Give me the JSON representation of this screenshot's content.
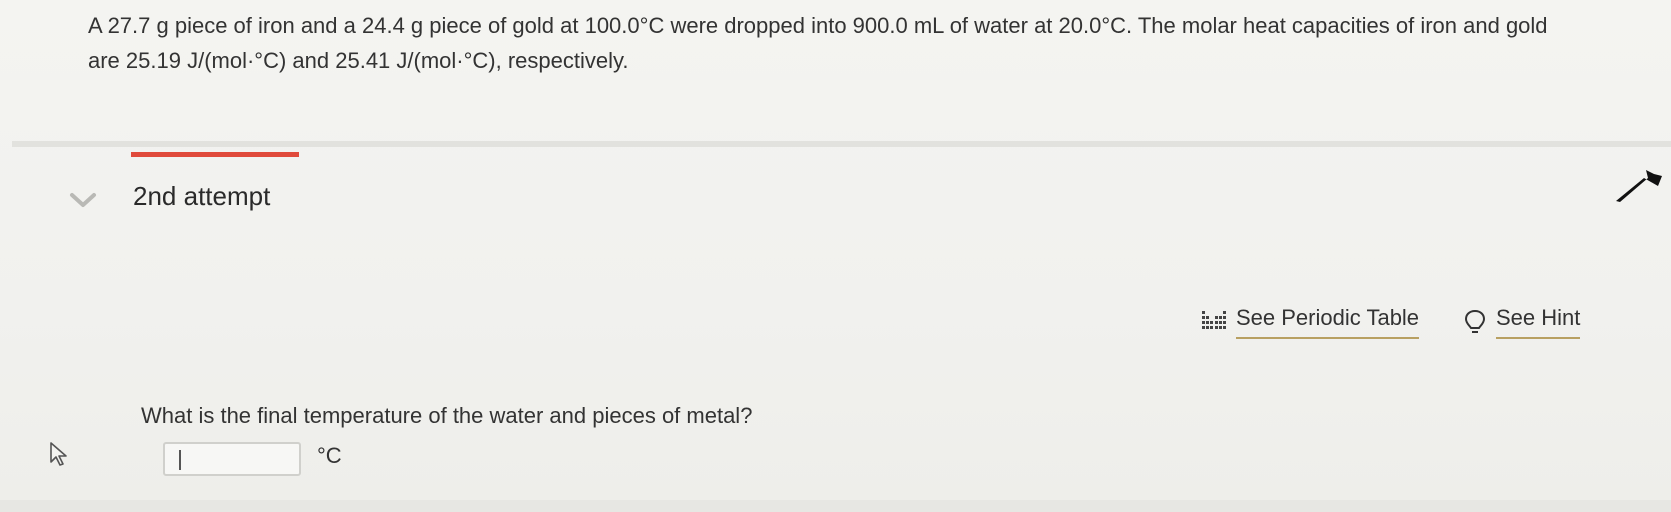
{
  "problem": {
    "line1": "A 27.7 g piece of iron and a 24.4 g piece of gold at 100.0°C were dropped into 900.0 mL of water at 20.0°C. The molar heat capacities of iron and gold",
    "line2": "are 25.19 J/(mol·°C) and 25.41 J/(mol·°C), respectively."
  },
  "attempt": {
    "title": "2nd attempt",
    "accent_color": "#e04a3b"
  },
  "tools": {
    "periodic_table_label": "See Periodic Table",
    "periodic_table_icon": "periodic-table-icon",
    "hint_label": "See Hint",
    "hint_icon": "lightbulb-icon"
  },
  "question": {
    "text": "What is the final temperature of the water and pieces of metal?",
    "answer_value": "",
    "unit": "°C"
  }
}
